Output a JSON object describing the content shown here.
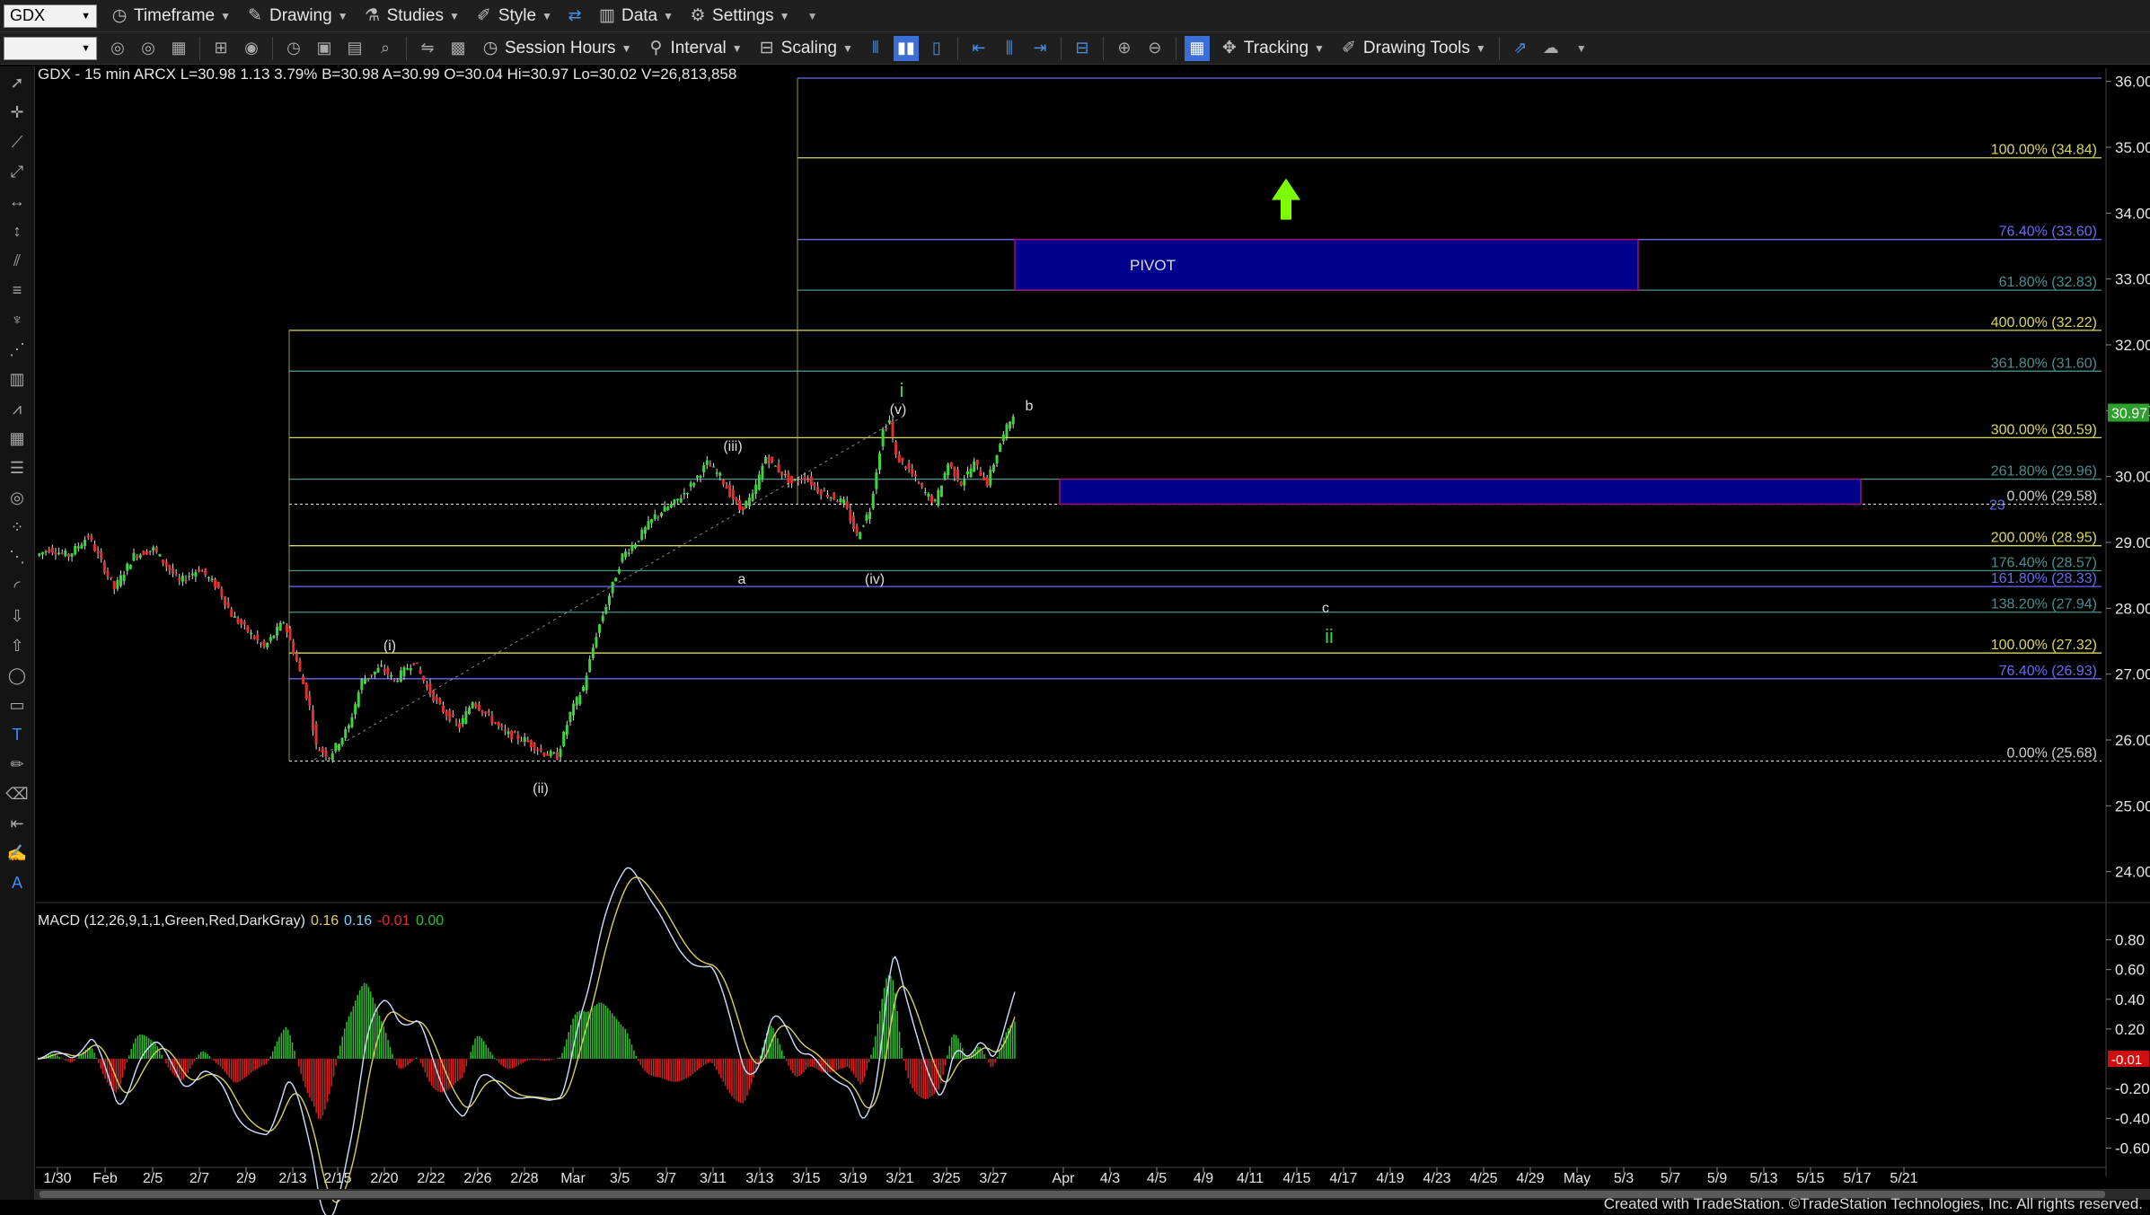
{
  "toolbar1": {
    "symbol": "GDX",
    "timeframe": "Timeframe",
    "drawing": "Drawing",
    "studies": "Studies",
    "style": "Style",
    "data": "Data",
    "settings": "Settings"
  },
  "toolbar2": {
    "session_hours": "Session Hours",
    "interval": "Interval",
    "scaling": "Scaling",
    "tracking": "Tracking",
    "drawing_tools": "Drawing Tools"
  },
  "chart_header": "GDX - 15 min  ARCX   L=30.98  1.13  3.79%  B=30.98  A=30.99  O=30.04  Hi=30.97  Lo=30.02  V=26,813,858",
  "macd_header": {
    "label": "MACD (12,26,9,1,1,Green,Red,DarkGray)",
    "v1": "0.16",
    "v2": "0.16",
    "v3": "-0.01",
    "v4": "0.00"
  },
  "footer": "Created with TradeStation. ©TradeStation Technologies, Inc. All rights reserved.",
  "colors": {
    "background": "#000000",
    "yellow_level": "#d8d860",
    "blue_level": "#6a6af0",
    "teal_level": "#4a8f8f",
    "pivot_box": "#00008c",
    "pivot_border": "#a01070",
    "green_wave": "#3fd43f",
    "arrow": "#7cfc00",
    "last_price_bg": "#2ea02e",
    "macd_neg_bg": "#d01010"
  },
  "chart_data": {
    "type": "candlestick",
    "symbol": "GDX",
    "interval": "15 min",
    "ylim": [
      23.6,
      36.2
    ],
    "y_ticks": [
      "24.00",
      "25.00",
      "26.00",
      "27.00",
      "28.00",
      "29.00",
      "30.00",
      "31.00",
      "32.00",
      "33.00",
      "34.00",
      "35.00",
      "36.00"
    ],
    "last_price": "30.97",
    "x_ticks": [
      "1/30",
      "Feb",
      "2/5",
      "2/7",
      "2/9",
      "2/13",
      "2/15",
      "2/20",
      "2/22",
      "2/26",
      "2/28",
      "Mar",
      "3/5",
      "3/7",
      "3/11",
      "3/13",
      "3/15",
      "3/19",
      "3/21",
      "3/25",
      "3/27",
      "Apr",
      "4/3",
      "4/5",
      "4/9",
      "4/11",
      "4/15",
      "4/17",
      "4/19",
      "4/23",
      "4/25",
      "4/29",
      "May",
      "5/3",
      "5/7",
      "5/9",
      "5/13",
      "5/15",
      "5/17",
      "5/21"
    ],
    "price_path": [
      [
        0,
        28.8
      ],
      [
        2,
        28.9
      ],
      [
        5,
        28.8
      ],
      [
        8,
        29.1
      ],
      [
        10,
        28.7
      ],
      [
        12,
        28.3
      ],
      [
        15,
        28.8
      ],
      [
        18,
        28.9
      ],
      [
        22,
        28.4
      ],
      [
        25,
        28.6
      ],
      [
        28,
        28.3
      ],
      [
        30,
        27.9
      ],
      [
        33,
        27.6
      ],
      [
        35,
        27.4
      ],
      [
        38,
        27.8
      ],
      [
        40,
        27.2
      ],
      [
        42,
        26.5
      ],
      [
        43,
        25.9
      ],
      [
        45,
        25.75
      ],
      [
        48,
        26.2
      ],
      [
        50,
        26.9
      ],
      [
        53,
        27.1
      ],
      [
        55,
        26.9
      ],
      [
        58,
        27.2
      ],
      [
        60,
        26.8
      ],
      [
        62,
        26.5
      ],
      [
        65,
        26.2
      ],
      [
        67,
        26.6
      ],
      [
        70,
        26.3
      ],
      [
        72,
        26.1
      ],
      [
        75,
        26.0
      ],
      [
        78,
        25.8
      ],
      [
        80,
        25.75
      ],
      [
        82,
        26.4
      ],
      [
        84,
        26.8
      ],
      [
        86,
        27.6
      ],
      [
        88,
        28.2
      ],
      [
        90,
        28.8
      ],
      [
        92,
        29.0
      ],
      [
        95,
        29.4
      ],
      [
        98,
        29.6
      ],
      [
        100,
        29.8
      ],
      [
        103,
        30.2
      ],
      [
        105,
        30.0
      ],
      [
        108,
        29.5
      ],
      [
        110,
        29.7
      ],
      [
        112,
        30.3
      ],
      [
        114,
        30.1
      ],
      [
        116,
        29.9
      ],
      [
        118,
        30.0
      ],
      [
        120,
        29.8
      ],
      [
        122,
        29.7
      ],
      [
        124,
        29.6
      ],
      [
        126,
        29.1
      ],
      [
        128,
        29.5
      ],
      [
        130,
        30.7
      ],
      [
        131,
        30.85
      ],
      [
        132,
        30.3
      ],
      [
        134,
        30.1
      ],
      [
        136,
        29.8
      ],
      [
        138,
        29.6
      ],
      [
        140,
        30.2
      ],
      [
        142,
        29.9
      ],
      [
        144,
        30.2
      ],
      [
        146,
        29.9
      ],
      [
        148,
        30.5
      ],
      [
        150,
        30.97
      ]
    ],
    "price_path_x_units": "bar index, 150 = last bar (3/27-3/28)",
    "fib_levels": [
      {
        "label": "100.00% (34.84)",
        "price": 34.84,
        "color": "yellow"
      },
      {
        "label": "76.40% (33.60)",
        "price": 33.6,
        "color": "blue"
      },
      {
        "label": "61.80% (32.83)",
        "price": 32.83,
        "color": "teal"
      },
      {
        "label": "400.00% (32.22)",
        "price": 32.22,
        "color": "yellow"
      },
      {
        "label": "361.80% (31.60)",
        "price": 31.6,
        "color": "teal"
      },
      {
        "label": "300.00% (30.59)",
        "price": 30.59,
        "color": "yellow"
      },
      {
        "label": "261.80% (29.96)",
        "price": 29.96,
        "color": "teal"
      },
      {
        "label": "23",
        "price": 29.58,
        "color": "blue"
      },
      {
        "label": "0.00% (29.58)",
        "price": 29.58,
        "color": "white"
      },
      {
        "label": "200.00% (28.95)",
        "price": 28.95,
        "color": "yellow"
      },
      {
        "label": "176.40% (28.57)",
        "price": 28.57,
        "color": "teal"
      },
      {
        "label": "161.80% (28.33)",
        "price": 28.33,
        "color": "blue"
      },
      {
        "label": "138.20% (27.94)",
        "price": 27.94,
        "color": "teal"
      },
      {
        "label": "100.00% (27.32)",
        "price": 27.32,
        "color": "yellow"
      },
      {
        "label": "76.40% (26.93)",
        "price": 26.93,
        "color": "blue"
      },
      {
        "label": "0.00% (25.68)",
        "price": 25.68,
        "color": "white"
      }
    ],
    "zones": [
      {
        "label": "PIVOT",
        "low": 32.83,
        "high": 33.6
      },
      {
        "label": "",
        "low": 29.58,
        "high": 29.96
      }
    ],
    "wave_labels": [
      {
        "text": "(i)",
        "color": "white"
      },
      {
        "text": "(ii)",
        "color": "white"
      },
      {
        "text": "(iii)",
        "color": "white"
      },
      {
        "text": "a",
        "color": "white"
      },
      {
        "text": "(iv)",
        "color": "white"
      },
      {
        "text": "(v)",
        "color": "white"
      },
      {
        "text": "i",
        "color": "green"
      },
      {
        "text": "b",
        "color": "white"
      },
      {
        "text": "c",
        "color": "white"
      },
      {
        "text": "ii",
        "color": "green"
      }
    ],
    "macd": {
      "ylim": [
        -0.7,
        0.9
      ],
      "y_ticks": [
        "0.80",
        "0.60",
        "0.40",
        "0.20",
        "-0.20",
        "-0.40",
        "-0.60"
      ],
      "current": "-0.01"
    }
  }
}
